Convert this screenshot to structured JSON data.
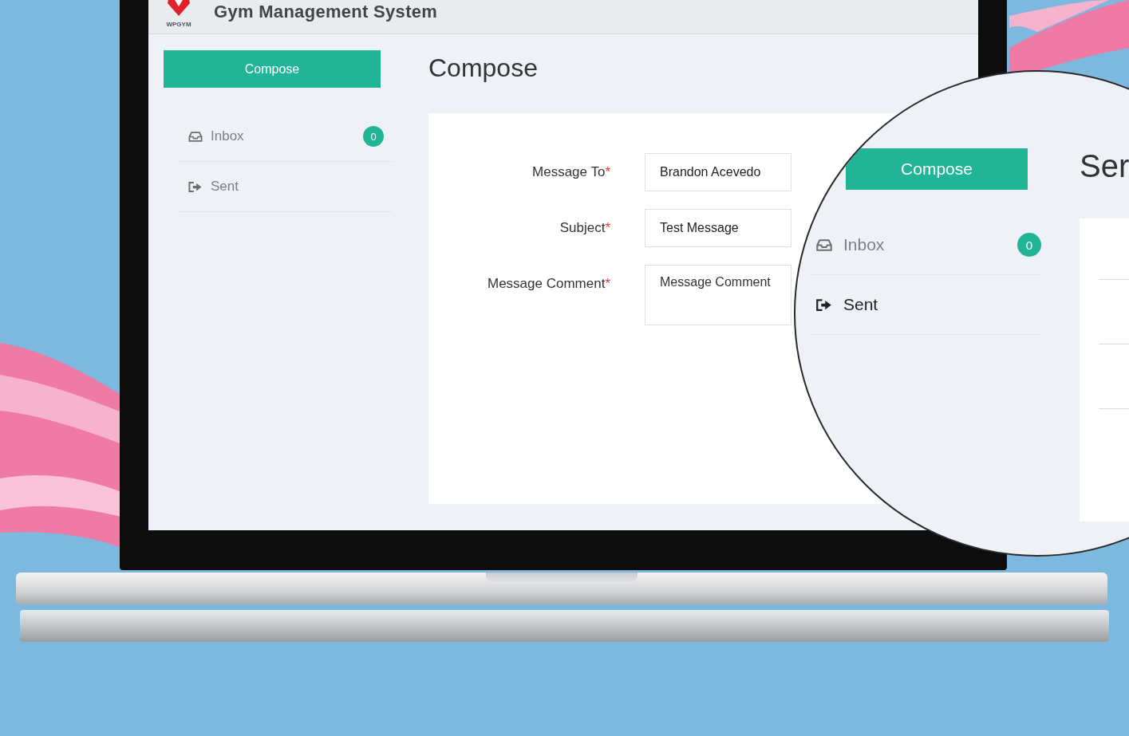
{
  "app": {
    "logo_text": "WPGYM",
    "title": "Gym Management System"
  },
  "sidebar": {
    "compose_button": "Compose",
    "items": [
      {
        "label": "Inbox",
        "kind": "inbox",
        "badge": "0",
        "selected": false
      },
      {
        "label": "Sent",
        "kind": "sent",
        "selected": false
      }
    ]
  },
  "page_title": "Compose",
  "form": {
    "fields": [
      {
        "label": "Message To",
        "required_mark": "*",
        "kind": "input",
        "value": "Brandon Acevedo"
      },
      {
        "label": "Subject",
        "required_mark": "*",
        "kind": "input",
        "value": "Test Message"
      },
      {
        "label": "Message Comment",
        "required_mark": "*",
        "kind": "textarea",
        "placeholder": "Message Comment"
      }
    ]
  },
  "magnifier": {
    "compose_button": "Compose",
    "items": [
      {
        "label": "Inbox",
        "kind": "inbox",
        "badge": "0",
        "selected": false
      },
      {
        "label": "Sent",
        "kind": "sent",
        "selected": true
      }
    ],
    "page_title": "Ser"
  }
}
